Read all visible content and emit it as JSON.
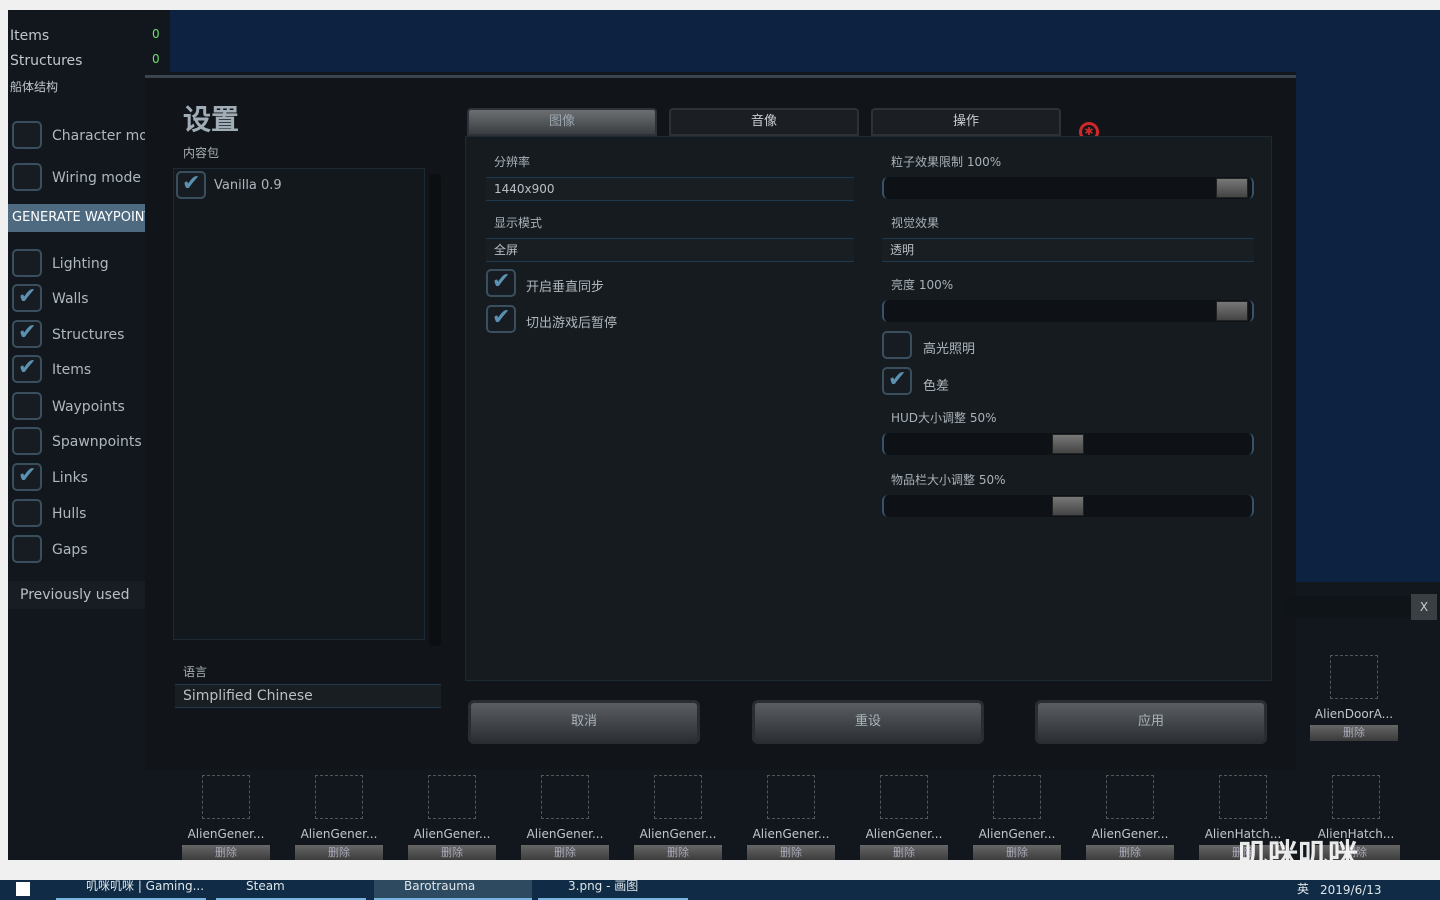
{
  "left_panel": {
    "stats": [
      {
        "label": "Items",
        "value": "0"
      },
      {
        "label": "Structures",
        "value": "0"
      }
    ],
    "hull_label": "船体结构",
    "character_mode": {
      "label": "Character mode",
      "checked": false
    },
    "wiring_mode": {
      "label": "Wiring mode",
      "checked": false
    },
    "generate_waypoints": "GENERATE WAYPOINTS",
    "toggles": [
      {
        "label": "Lighting",
        "checked": false
      },
      {
        "label": "Walls",
        "checked": true
      },
      {
        "label": "Structures",
        "checked": true
      },
      {
        "label": "Items",
        "checked": true
      },
      {
        "label": "Waypoints",
        "checked": false
      },
      {
        "label": "Spawnpoints",
        "checked": false
      },
      {
        "label": "Links",
        "checked": true
      },
      {
        "label": "Hulls",
        "checked": false
      },
      {
        "label": "Gaps",
        "checked": false
      }
    ],
    "previously_used": "Previously used"
  },
  "settings": {
    "title": "设置",
    "content_packages_label": "内容包",
    "content_packages": [
      {
        "label": "Vanilla 0.9",
        "checked": true
      }
    ],
    "language_label": "语言",
    "language_value": "Simplified Chinese",
    "tabs": [
      {
        "label": "图像",
        "active": true
      },
      {
        "label": "音像",
        "active": false
      },
      {
        "label": "操作",
        "active": false
      }
    ],
    "bug_icon": "bug-report-icon",
    "resolution_label": "分辨率",
    "resolution_value": "1440x900",
    "display_mode_label": "显示模式",
    "display_mode_value": "全屏",
    "vsync": {
      "label": "开启垂直同步",
      "checked": true
    },
    "pause_on_focus_lost": {
      "label": "切出游戏后暂停",
      "checked": true
    },
    "particle_limit": {
      "label": "粒子效果限制 100%",
      "value": 100
    },
    "visual_effects_label": "视觉效果",
    "visual_effects_value": "透明",
    "brightness": {
      "label": "亮度 100%",
      "value": 100
    },
    "specular": {
      "label": "高光照明",
      "checked": false
    },
    "chromatic": {
      "label": "色差",
      "checked": true
    },
    "hud_scale": {
      "label": "HUD大小调整 50%",
      "value": 50
    },
    "inventory_scale": {
      "label": "物品栏大小调整 50%",
      "value": 50
    },
    "cancel": "取消",
    "reset": "重设",
    "apply": "应用"
  },
  "close_label": "X",
  "items": [
    {
      "name": "AlienGener...",
      "del": "删除"
    },
    {
      "name": "AlienGener...",
      "del": "删除"
    },
    {
      "name": "AlienGener...",
      "del": "删除"
    },
    {
      "name": "AlienGener...",
      "del": "删除"
    },
    {
      "name": "AlienGener...",
      "del": "删除"
    },
    {
      "name": "AlienGener...",
      "del": "删除"
    },
    {
      "name": "AlienGener...",
      "del": "删除"
    },
    {
      "name": "AlienGener...",
      "del": "删除"
    },
    {
      "name": "AlienGener...",
      "del": "删除"
    },
    {
      "name": "AlienHatch...",
      "del": "删除"
    },
    {
      "name": "AlienHatch...",
      "del": "删除"
    }
  ],
  "side_item": {
    "name": "AlienDoorA...",
    "del": "删除"
  },
  "watermark": "叽咪叽咪",
  "taskbar": {
    "apps": [
      "叽咪叽咪 | Gaming...",
      "Steam",
      "Barotrauma",
      "3.png - 画图"
    ],
    "ime": "英",
    "date": "2019/6/13"
  }
}
